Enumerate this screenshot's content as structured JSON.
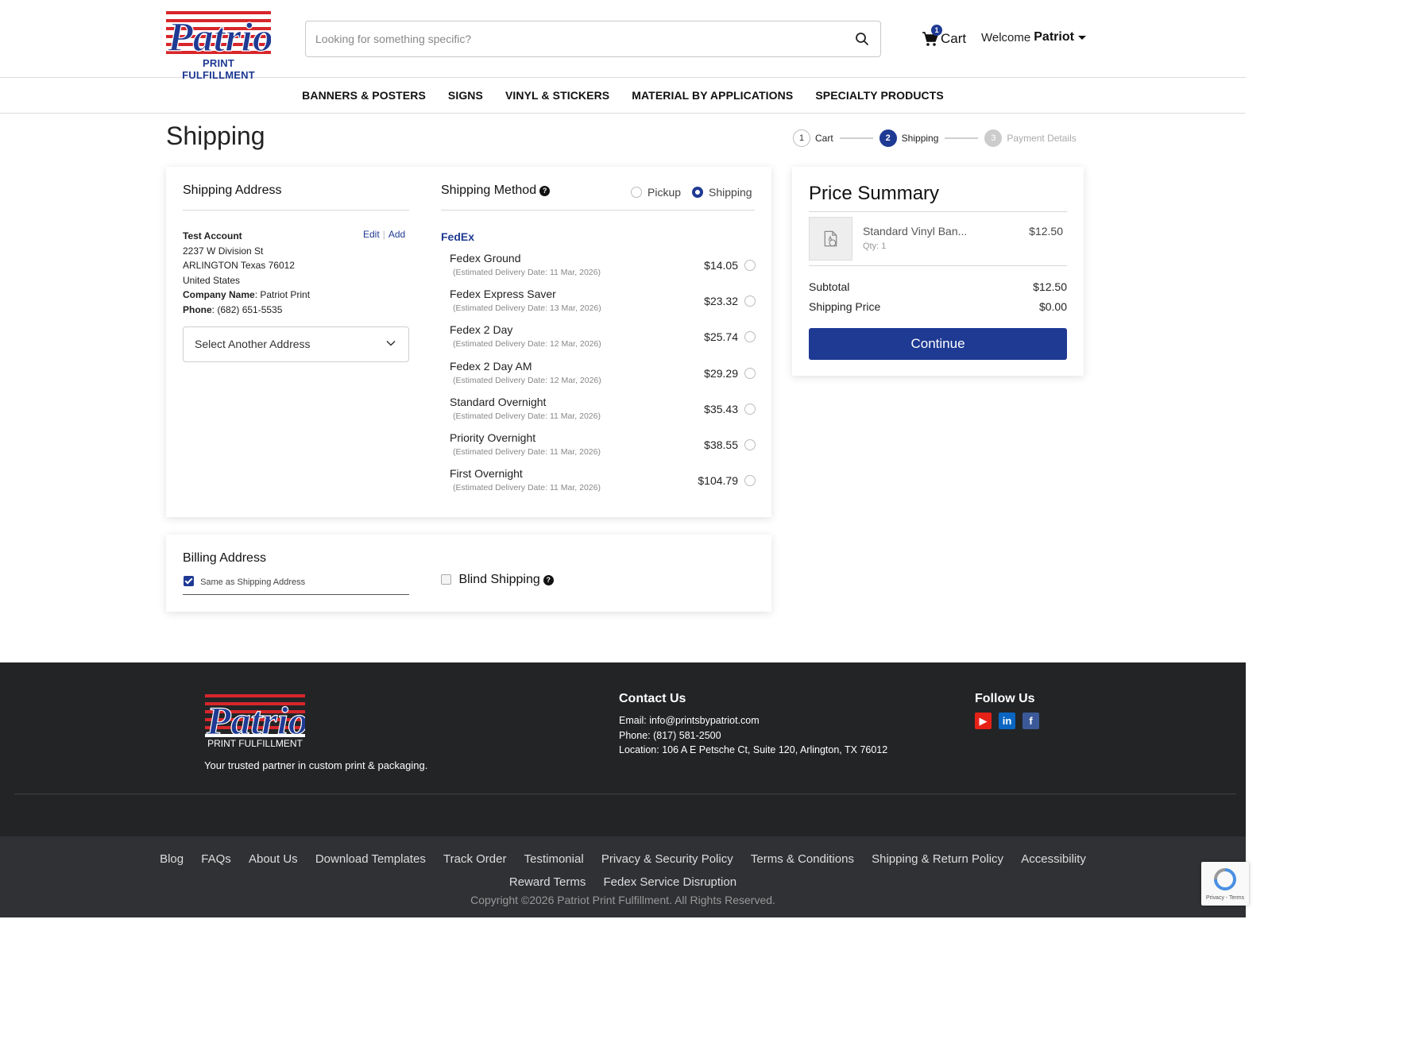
{
  "header": {
    "logo_text": "Patriot",
    "logo_sub": "PRINT FULFILLMENT",
    "search_placeholder": "Looking for something specific?",
    "cart_label": "Cart",
    "cart_count": "1",
    "welcome": "Welcome",
    "user_name": "Patriot"
  },
  "nav": [
    "BANNERS & POSTERS",
    "SIGNS",
    "VINYL & STICKERS",
    "MATERIAL BY APPLICATIONS",
    "SPECIALTY PRODUCTS"
  ],
  "page_title": "Shipping",
  "stepper": [
    {
      "num": "1",
      "label": "Cart"
    },
    {
      "num": "2",
      "label": "Shipping"
    },
    {
      "num": "3",
      "label": "Payment Details"
    }
  ],
  "shipping_address": {
    "heading": "Shipping Address",
    "name": "Test Account",
    "line1": "2237 W Division St",
    "line2": "ARLINGTON Texas 76012",
    "country": "United States",
    "company_label": "Company Name",
    "company": "Patriot Print",
    "phone_label": "Phone",
    "phone": "(682) 651-5535",
    "edit": "Edit",
    "add": "Add",
    "select_another": "Select Another Address"
  },
  "shipping_method": {
    "heading": "Shipping Method",
    "pickup": "Pickup",
    "shipping": "Shipping",
    "carrier": "FedEx",
    "rates": [
      {
        "name": "Fedex Ground",
        "date": "(Estimated Delivery Date: 11 Mar, 2026)",
        "price": "$14.05"
      },
      {
        "name": "Fedex Express Saver",
        "date": "(Estimated Delivery Date: 13 Mar, 2026)",
        "price": "$23.32"
      },
      {
        "name": "Fedex 2 Day",
        "date": "(Estimated Delivery Date: 12 Mar, 2026)",
        "price": "$25.74"
      },
      {
        "name": "Fedex 2 Day AM",
        "date": "(Estimated Delivery Date: 12 Mar, 2026)",
        "price": "$29.29"
      },
      {
        "name": "Standard Overnight",
        "date": "(Estimated Delivery Date: 11 Mar, 2026)",
        "price": "$35.43"
      },
      {
        "name": "Priority Overnight",
        "date": "(Estimated Delivery Date: 11 Mar, 2026)",
        "price": "$38.55"
      },
      {
        "name": "First Overnight",
        "date": "(Estimated Delivery Date: 11 Mar, 2026)",
        "price": "$104.79"
      }
    ]
  },
  "billing": {
    "heading": "Billing Address",
    "same_as": "Same as Shipping Address",
    "blind_shipping": "Blind Shipping"
  },
  "price_summary": {
    "heading": "Price Summary",
    "item_name": "Standard Vinyl Ban...",
    "item_qty": "Qty: 1",
    "item_price": "$12.50",
    "subtotal_label": "Subtotal",
    "subtotal": "$12.50",
    "shipping_label": "Shipping Price",
    "shipping": "$0.00",
    "continue": "Continue"
  },
  "footer": {
    "tagline": "Your trusted partner in custom print & packaging.",
    "contact_heading": "Contact Us",
    "email_label": "Email:",
    "email": "info@printsbypatriot.com",
    "phone_label": "Phone:",
    "phone": "(817) 581-2500",
    "location_label": "Location:",
    "location": "106 A E Petsche Ct, Suite 120, Arlington, TX 76012",
    "follow_heading": "Follow Us",
    "links_row1": [
      "Blog",
      "FAQs",
      "About Us",
      "Download Templates",
      "Track Order",
      "Testimonial",
      "Privacy & Security Policy",
      "Terms & Conditions",
      "Shipping & Return Policy",
      "Accessibility"
    ],
    "links_row2": [
      "Reward Terms",
      "Fedex Service Disruption"
    ],
    "copyright": "Copyright ©2026 Patriot Print Fulfillment. All Rights Reserved.",
    "recaptcha": "Privacy - Terms"
  },
  "colors": {
    "brand_blue": "#1f3a93",
    "logo_red": "#d7262b",
    "footer_bg": "#232426"
  }
}
